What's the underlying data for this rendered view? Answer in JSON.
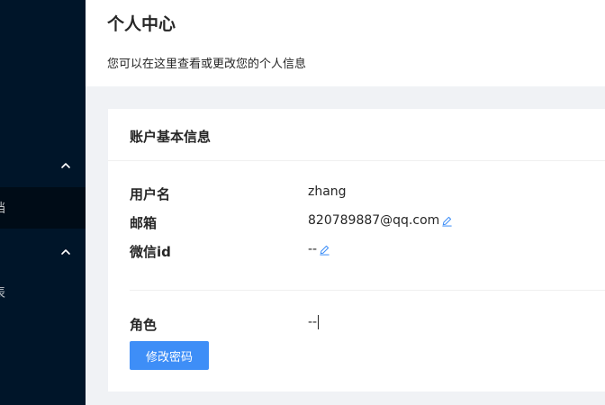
{
  "sidebar": {
    "groups": [
      {
        "sub_label": "档"
      },
      {
        "sub_label": "表"
      }
    ]
  },
  "header": {
    "title": "个人中心",
    "description": "您可以在这里查看或更改您的个人信息"
  },
  "card": {
    "title": "账户基本信息",
    "fields": {
      "username": {
        "label": "用户名",
        "value": "zhang"
      },
      "email": {
        "label": "邮箱",
        "value": "820789887@qq.com"
      },
      "wechat": {
        "label": "微信id",
        "value": "--"
      },
      "role": {
        "label": "角色",
        "value": "--"
      }
    },
    "change_password_label": "修改密码"
  },
  "colors": {
    "sidebar_bg": "#001529",
    "submenu_bg": "#000c17",
    "primary": "#3e8ef7",
    "page_bg": "#f0f2f5"
  }
}
